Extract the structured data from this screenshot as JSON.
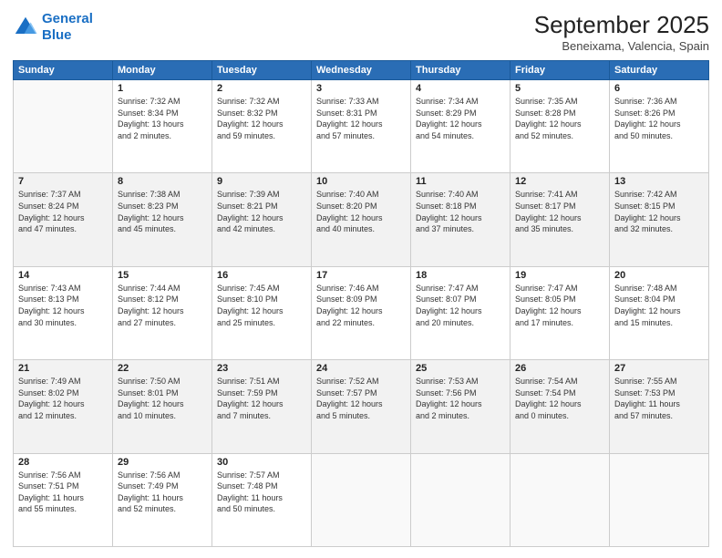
{
  "logo": {
    "line1": "General",
    "line2": "Blue"
  },
  "title": "September 2025",
  "subtitle": "Beneixama, Valencia, Spain",
  "weekdays": [
    "Sunday",
    "Monday",
    "Tuesday",
    "Wednesday",
    "Thursday",
    "Friday",
    "Saturday"
  ],
  "weeks": [
    [
      {
        "day": "",
        "info": ""
      },
      {
        "day": "1",
        "info": "Sunrise: 7:32 AM\nSunset: 8:34 PM\nDaylight: 13 hours\nand 2 minutes."
      },
      {
        "day": "2",
        "info": "Sunrise: 7:32 AM\nSunset: 8:32 PM\nDaylight: 12 hours\nand 59 minutes."
      },
      {
        "day": "3",
        "info": "Sunrise: 7:33 AM\nSunset: 8:31 PM\nDaylight: 12 hours\nand 57 minutes."
      },
      {
        "day": "4",
        "info": "Sunrise: 7:34 AM\nSunset: 8:29 PM\nDaylight: 12 hours\nand 54 minutes."
      },
      {
        "day": "5",
        "info": "Sunrise: 7:35 AM\nSunset: 8:28 PM\nDaylight: 12 hours\nand 52 minutes."
      },
      {
        "day": "6",
        "info": "Sunrise: 7:36 AM\nSunset: 8:26 PM\nDaylight: 12 hours\nand 50 minutes."
      }
    ],
    [
      {
        "day": "7",
        "info": "Sunrise: 7:37 AM\nSunset: 8:24 PM\nDaylight: 12 hours\nand 47 minutes."
      },
      {
        "day": "8",
        "info": "Sunrise: 7:38 AM\nSunset: 8:23 PM\nDaylight: 12 hours\nand 45 minutes."
      },
      {
        "day": "9",
        "info": "Sunrise: 7:39 AM\nSunset: 8:21 PM\nDaylight: 12 hours\nand 42 minutes."
      },
      {
        "day": "10",
        "info": "Sunrise: 7:40 AM\nSunset: 8:20 PM\nDaylight: 12 hours\nand 40 minutes."
      },
      {
        "day": "11",
        "info": "Sunrise: 7:40 AM\nSunset: 8:18 PM\nDaylight: 12 hours\nand 37 minutes."
      },
      {
        "day": "12",
        "info": "Sunrise: 7:41 AM\nSunset: 8:17 PM\nDaylight: 12 hours\nand 35 minutes."
      },
      {
        "day": "13",
        "info": "Sunrise: 7:42 AM\nSunset: 8:15 PM\nDaylight: 12 hours\nand 32 minutes."
      }
    ],
    [
      {
        "day": "14",
        "info": "Sunrise: 7:43 AM\nSunset: 8:13 PM\nDaylight: 12 hours\nand 30 minutes."
      },
      {
        "day": "15",
        "info": "Sunrise: 7:44 AM\nSunset: 8:12 PM\nDaylight: 12 hours\nand 27 minutes."
      },
      {
        "day": "16",
        "info": "Sunrise: 7:45 AM\nSunset: 8:10 PM\nDaylight: 12 hours\nand 25 minutes."
      },
      {
        "day": "17",
        "info": "Sunrise: 7:46 AM\nSunset: 8:09 PM\nDaylight: 12 hours\nand 22 minutes."
      },
      {
        "day": "18",
        "info": "Sunrise: 7:47 AM\nSunset: 8:07 PM\nDaylight: 12 hours\nand 20 minutes."
      },
      {
        "day": "19",
        "info": "Sunrise: 7:47 AM\nSunset: 8:05 PM\nDaylight: 12 hours\nand 17 minutes."
      },
      {
        "day": "20",
        "info": "Sunrise: 7:48 AM\nSunset: 8:04 PM\nDaylight: 12 hours\nand 15 minutes."
      }
    ],
    [
      {
        "day": "21",
        "info": "Sunrise: 7:49 AM\nSunset: 8:02 PM\nDaylight: 12 hours\nand 12 minutes."
      },
      {
        "day": "22",
        "info": "Sunrise: 7:50 AM\nSunset: 8:01 PM\nDaylight: 12 hours\nand 10 minutes."
      },
      {
        "day": "23",
        "info": "Sunrise: 7:51 AM\nSunset: 7:59 PM\nDaylight: 12 hours\nand 7 minutes."
      },
      {
        "day": "24",
        "info": "Sunrise: 7:52 AM\nSunset: 7:57 PM\nDaylight: 12 hours\nand 5 minutes."
      },
      {
        "day": "25",
        "info": "Sunrise: 7:53 AM\nSunset: 7:56 PM\nDaylight: 12 hours\nand 2 minutes."
      },
      {
        "day": "26",
        "info": "Sunrise: 7:54 AM\nSunset: 7:54 PM\nDaylight: 12 hours\nand 0 minutes."
      },
      {
        "day": "27",
        "info": "Sunrise: 7:55 AM\nSunset: 7:53 PM\nDaylight: 11 hours\nand 57 minutes."
      }
    ],
    [
      {
        "day": "28",
        "info": "Sunrise: 7:56 AM\nSunset: 7:51 PM\nDaylight: 11 hours\nand 55 minutes."
      },
      {
        "day": "29",
        "info": "Sunrise: 7:56 AM\nSunset: 7:49 PM\nDaylight: 11 hours\nand 52 minutes."
      },
      {
        "day": "30",
        "info": "Sunrise: 7:57 AM\nSunset: 7:48 PM\nDaylight: 11 hours\nand 50 minutes."
      },
      {
        "day": "",
        "info": ""
      },
      {
        "day": "",
        "info": ""
      },
      {
        "day": "",
        "info": ""
      },
      {
        "day": "",
        "info": ""
      }
    ]
  ]
}
